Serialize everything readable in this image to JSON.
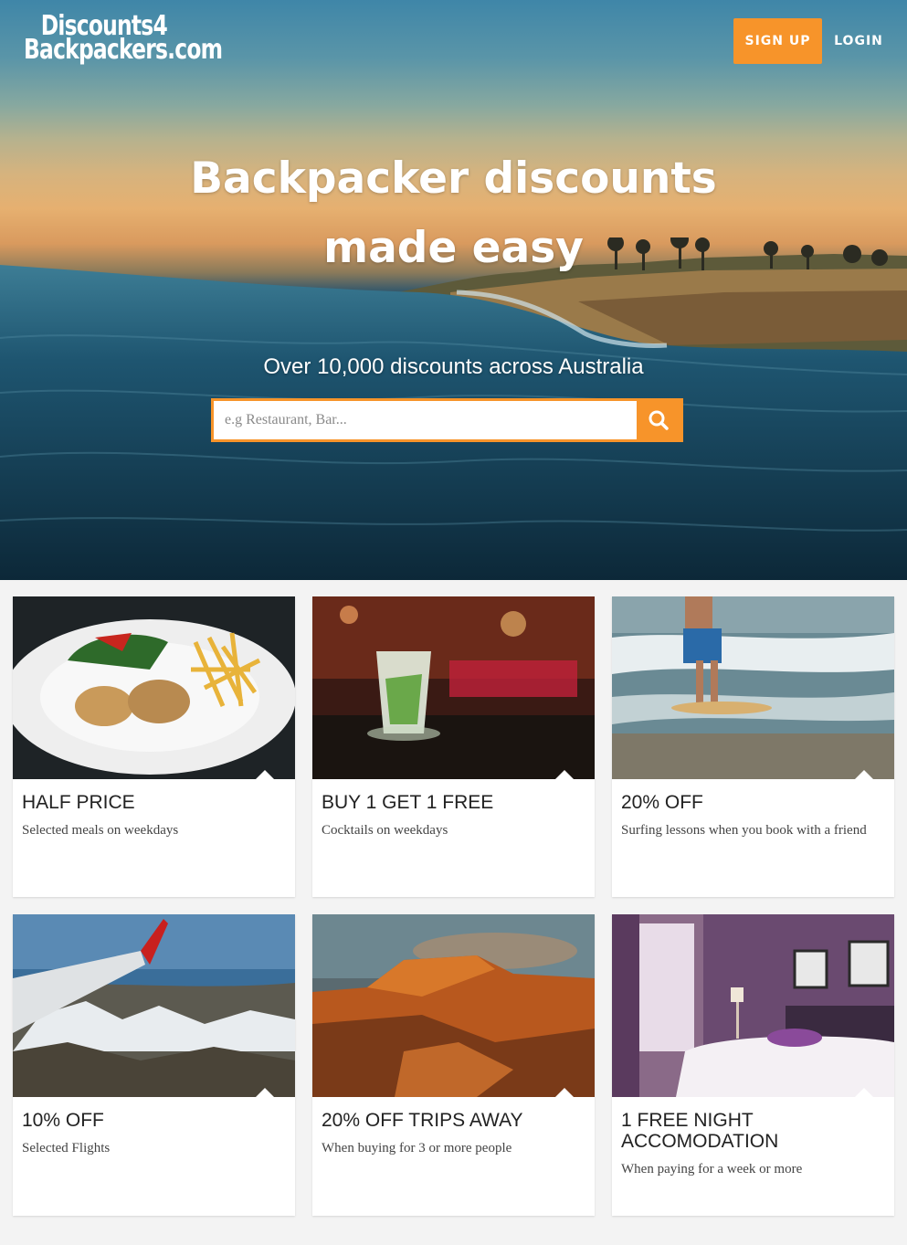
{
  "header": {
    "logo_line1": "Discounts4",
    "logo_line2": "Backpackers.com",
    "signup_label": "SIGN UP",
    "login_label": "LOGIN"
  },
  "hero": {
    "headline_line1": "Backpacker discounts",
    "headline_line2": "made easy",
    "subline": "Over 10,000 discounts across Australia",
    "search_placeholder": "e.g Restaurant, Bar...",
    "search_value": ""
  },
  "colors": {
    "accent": "#f7942a",
    "card_bg": "#ffffff",
    "page_bg": "#f3f3f3"
  },
  "deals": [
    {
      "title": "HALF PRICE",
      "description": "Selected meals on weekdays",
      "image": "meal-image"
    },
    {
      "title": "BUY 1 GET 1 FREE",
      "description": "Cocktails on weekdays",
      "image": "cocktail-image"
    },
    {
      "title": "20% OFF",
      "description": "Surfing lessons when you book with a friend",
      "image": "surfing-image"
    },
    {
      "title": "10% OFF",
      "description": "Selected Flights",
      "image": "airplane-wing-image"
    },
    {
      "title": "20% OFF TRIPS AWAY",
      "description": "When buying for 3 or more people",
      "image": "outback-canyon-image"
    },
    {
      "title": "1 FREE NIGHT ACCOMODATION",
      "description": "When paying for a week or more",
      "image": "hotel-room-image"
    }
  ]
}
